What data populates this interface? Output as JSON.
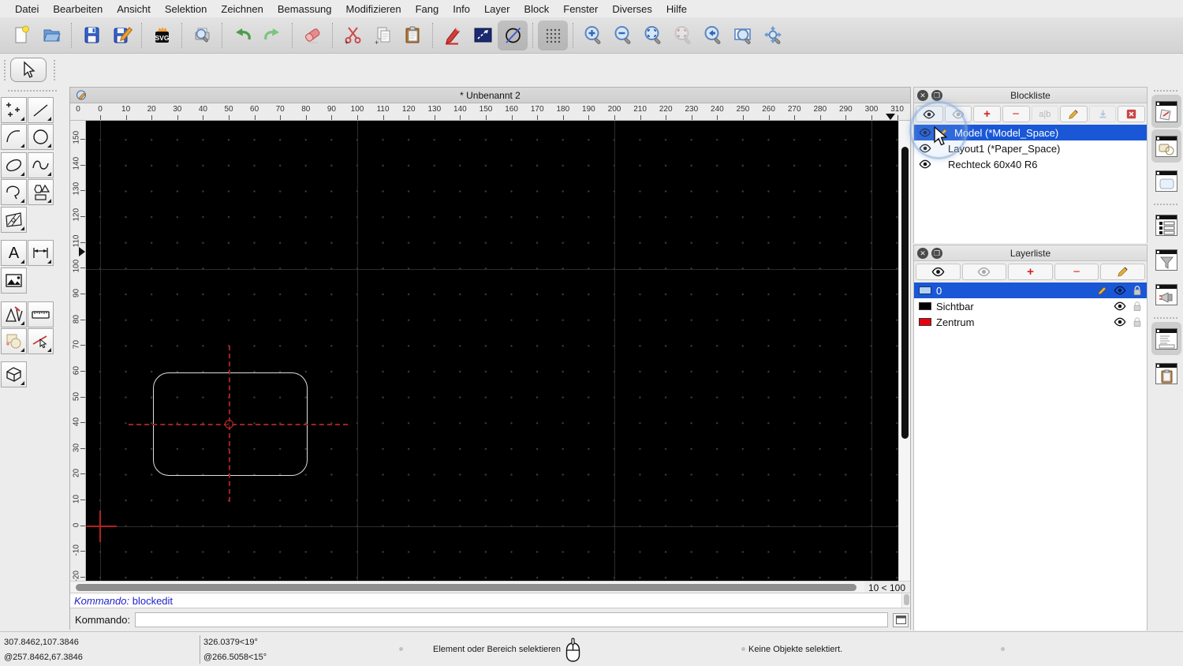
{
  "app": {
    "selection_color": "#1957d6",
    "canvas_accent_red": "#b22222",
    "entity_color": "#dedede"
  },
  "menu": {
    "items": [
      "Datei",
      "Bearbeiten",
      "Ansicht",
      "Selektion",
      "Zeichnen",
      "Bemassung",
      "Modifizieren",
      "Fang",
      "Info",
      "Layer",
      "Block",
      "Fenster",
      "Diverses",
      "Hilfe"
    ]
  },
  "toolbar": {
    "buttons": [
      "new-file",
      "open-file",
      "save",
      "save-as",
      "svg-export",
      "print-preview",
      "undo",
      "redo",
      "eraser",
      "cut",
      "copy",
      "paste",
      "pen-attributes",
      "line-attributes",
      "circle-tool",
      "grid-toggle",
      "zoom-in",
      "zoom-out",
      "zoom-auto",
      "zoom-selection",
      "zoom-previous",
      "zoom-window",
      "zoom-pan"
    ]
  },
  "left_palette": {
    "buttons": [
      "points",
      "line",
      "arc",
      "circle",
      "ellipse",
      "spline",
      "polyline",
      "polygon-shapes",
      "hatch",
      "text",
      "dimension",
      "image",
      "construction",
      "measure",
      "modify",
      "select-entity",
      "solid-3d"
    ]
  },
  "document": {
    "title": "* Unbenannt 2",
    "zoom_indicator": "10 < 100"
  },
  "rulers": {
    "corner": "0",
    "top": [
      "0",
      "10",
      "20",
      "30",
      "40",
      "50",
      "60",
      "70",
      "80",
      "90",
      "100",
      "110",
      "120",
      "130",
      "140",
      "150",
      "160",
      "170",
      "180",
      "190",
      "200",
      "210",
      "220",
      "230",
      "240",
      "250",
      "260",
      "270",
      "280",
      "290",
      "300",
      "310"
    ],
    "left": [
      "150",
      "140",
      "130",
      "120",
      "110",
      "100",
      "90",
      "80",
      "70",
      "60",
      "50",
      "40",
      "30",
      "20",
      "10",
      "0",
      "-10",
      "-20"
    ]
  },
  "command": {
    "history_prompt": "Kommando:",
    "history_entry": "blockedit",
    "prompt": "Kommando:",
    "input_value": ""
  },
  "blockliste": {
    "title": "Blockliste",
    "tool_icons": [
      "show-all-blocks",
      "hide-all-blocks",
      "add-block",
      "remove-block",
      "rename-block",
      "edit-block",
      "insert-block",
      "delete-block"
    ],
    "rename_label": "a|b",
    "rows": [
      {
        "label": "Model (*Model_Space)",
        "selected": true
      },
      {
        "label": "Layout1 (*Paper_Space)",
        "selected": false
      },
      {
        "label": "Rechteck 60x40 R6",
        "selected": false
      }
    ]
  },
  "layerliste": {
    "title": "Layerliste",
    "tool_icons": [
      "show-all-layers",
      "hide-all-layers",
      "add-layer",
      "remove-layer",
      "edit-layer"
    ],
    "rows": [
      {
        "label": "0",
        "color": "#b5d0ee",
        "selected": true
      },
      {
        "label": "Sichtbar",
        "color": "#000000",
        "selected": false
      },
      {
        "label": "Zentrum",
        "color": "#e8000d",
        "selected": false
      }
    ]
  },
  "dock_strip": {
    "buttons": [
      "pen-attributes-dock",
      "block-dock",
      "library-dock",
      "layer-list-dock",
      "filter-dock",
      "command-echo-dock",
      "command-line-dock",
      "clipboard-dock"
    ]
  },
  "statusbar": {
    "abs_coord": "307.8462,107.3846",
    "rel_coord": "@257.8462,67.3846",
    "abs_polar": "326.0379<19°",
    "rel_polar": "@266.5058<15°",
    "hint": "Element oder Bereich selektieren",
    "selection_info": "Keine Objekte selektiert."
  }
}
